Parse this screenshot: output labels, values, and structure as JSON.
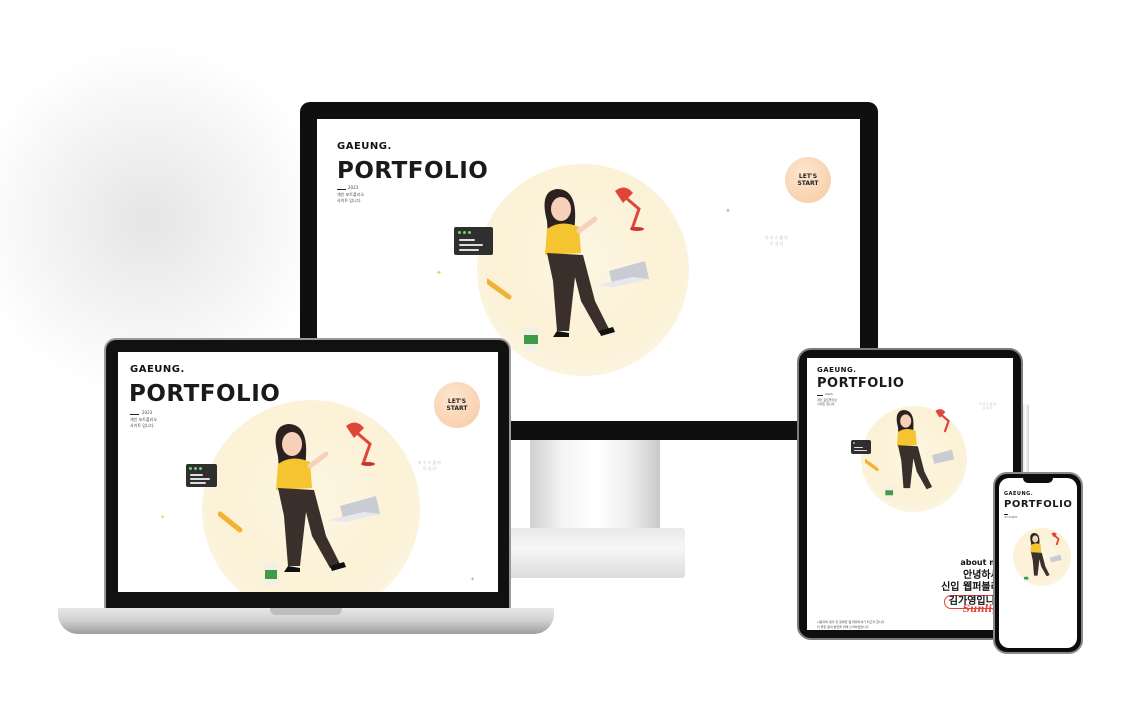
{
  "brand": "GAEUNG.",
  "hero_title": "PORTFOLIO",
  "year": "2023",
  "subtitle_line1": "개인 포트폴리오",
  "subtitle_line2": "사이트 입니다.",
  "cta_label_line1": "LET'S",
  "cta_label_line2": "START",
  "side_note_line1": "마 우 스 를 위",
  "side_note_line2": "로 내 려",
  "about_heading": "about me",
  "about_line1": "안녕하세요",
  "about_line2": "신입 웹퍼블리셔",
  "about_line3": "김가영입니다",
  "about_script": "Sunlight",
  "about_desc1": "사용자와 생각 한 정확한 웹 퍼블리셔가 되고자 합니다",
  "about_desc2": "더 좋은 웹의 발전을 위해 노력하겠습니다",
  "colors": {
    "accent_circle": "#fbf1d6",
    "cta_bg": "#f7c9a2",
    "shirt": "#f5c431",
    "pants": "#3a2f2a",
    "lamp": "#e0453a",
    "script": "#e0453a"
  },
  "icons": [
    "code-window-icon",
    "pencil-icon",
    "coffee-cup-icon",
    "desk-lamp-icon",
    "laptop-icon",
    "sparkle-icon"
  ]
}
